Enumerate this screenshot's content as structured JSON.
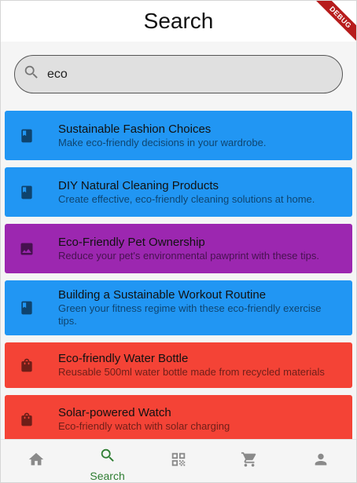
{
  "app_bar": {
    "title": "Search",
    "debug_banner": "DEBUG"
  },
  "search": {
    "value": "eco",
    "icon": "search-icon"
  },
  "results": [
    {
      "title": "Sustainable Fashion Choices",
      "subtitle": "Make eco-friendly decisions in your wardrobe.",
      "icon": "book-icon",
      "color": "#2196F3"
    },
    {
      "title": "DIY Natural Cleaning Products",
      "subtitle": "Create effective, eco-friendly cleaning solutions at home.",
      "icon": "book-icon",
      "color": "#2196F3"
    },
    {
      "title": "Eco-Friendly Pet Ownership",
      "subtitle": "Reduce your pet's environmental pawprint with these tips.",
      "icon": "image-icon",
      "color": "#9C27B0"
    },
    {
      "title": "Building a Sustainable Workout Routine",
      "subtitle": "Green your fitness regime with these eco-friendly exercise tips.",
      "icon": "book-icon",
      "color": "#2196F3"
    },
    {
      "title": "Eco-friendly Water Bottle",
      "subtitle": "Reusable 500ml water bottle made from recycled materials",
      "icon": "shopping-bag-icon",
      "color": "#F44336"
    },
    {
      "title": "Solar-powered Watch",
      "subtitle": "Eco-friendly watch with solar charging",
      "icon": "shopping-bag-icon",
      "color": "#F44336"
    }
  ],
  "bottom_nav": {
    "items": [
      {
        "icon": "home-icon",
        "label": ""
      },
      {
        "icon": "search-icon",
        "label": "Search",
        "active": true
      },
      {
        "icon": "qr-code-icon",
        "label": ""
      },
      {
        "icon": "cart-icon",
        "label": ""
      },
      {
        "icon": "person-icon",
        "label": ""
      }
    ],
    "active_color": "#2E7D32",
    "inactive_color": "#8A8A8A"
  }
}
